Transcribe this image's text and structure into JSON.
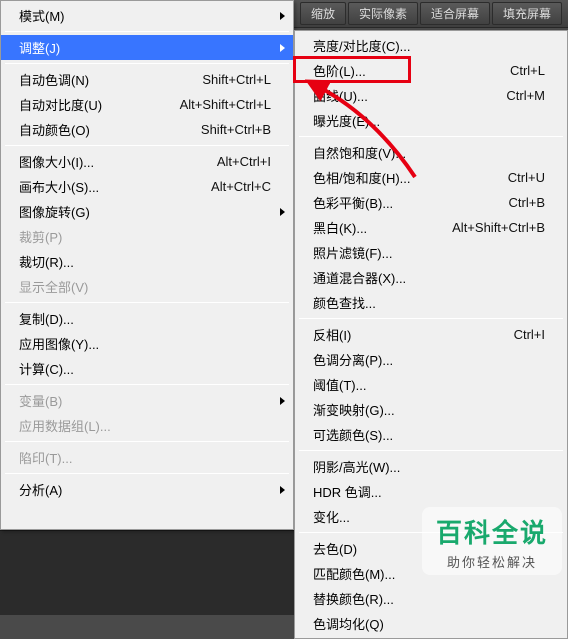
{
  "toolbar": {
    "buttons": [
      "缩放",
      "实际像素",
      "适合屏幕",
      "填充屏幕"
    ]
  },
  "left_menu": [
    {
      "type": "item",
      "label": "模式(M)",
      "shortcut": "",
      "arrow": true
    },
    {
      "type": "sep"
    },
    {
      "type": "item",
      "label": "调整(J)",
      "shortcut": "",
      "arrow": true,
      "highlight": true
    },
    {
      "type": "sep"
    },
    {
      "type": "item",
      "label": "自动色调(N)",
      "shortcut": "Shift+Ctrl+L"
    },
    {
      "type": "item",
      "label": "自动对比度(U)",
      "shortcut": "Alt+Shift+Ctrl+L"
    },
    {
      "type": "item",
      "label": "自动颜色(O)",
      "shortcut": "Shift+Ctrl+B"
    },
    {
      "type": "sep"
    },
    {
      "type": "item",
      "label": "图像大小(I)...",
      "shortcut": "Alt+Ctrl+I"
    },
    {
      "type": "item",
      "label": "画布大小(S)...",
      "shortcut": "Alt+Ctrl+C"
    },
    {
      "type": "item",
      "label": "图像旋转(G)",
      "shortcut": "",
      "arrow": true
    },
    {
      "type": "item",
      "label": "裁剪(P)",
      "disabled": true
    },
    {
      "type": "item",
      "label": "裁切(R)..."
    },
    {
      "type": "item",
      "label": "显示全部(V)",
      "disabled": true
    },
    {
      "type": "sep"
    },
    {
      "type": "item",
      "label": "复制(D)..."
    },
    {
      "type": "item",
      "label": "应用图像(Y)..."
    },
    {
      "type": "item",
      "label": "计算(C)..."
    },
    {
      "type": "sep"
    },
    {
      "type": "item",
      "label": "变量(B)",
      "arrow": true,
      "disabled": true
    },
    {
      "type": "item",
      "label": "应用数据组(L)...",
      "disabled": true
    },
    {
      "type": "sep"
    },
    {
      "type": "item",
      "label": "陷印(T)...",
      "disabled": true
    },
    {
      "type": "sep"
    },
    {
      "type": "item",
      "label": "分析(A)",
      "arrow": true
    }
  ],
  "right_menu": [
    {
      "type": "item",
      "label": "亮度/对比度(C)..."
    },
    {
      "type": "item",
      "label": "色阶(L)...",
      "shortcut": "Ctrl+L",
      "boxed": true
    },
    {
      "type": "item",
      "label": "曲线(U)...",
      "shortcut": "Ctrl+M"
    },
    {
      "type": "item",
      "label": "曝光度(E)..."
    },
    {
      "type": "sep"
    },
    {
      "type": "item",
      "label": "自然饱和度(V)..."
    },
    {
      "type": "item",
      "label": "色相/饱和度(H)...",
      "shortcut": "Ctrl+U"
    },
    {
      "type": "item",
      "label": "色彩平衡(B)...",
      "shortcut": "Ctrl+B"
    },
    {
      "type": "item",
      "label": "黑白(K)...",
      "shortcut": "Alt+Shift+Ctrl+B"
    },
    {
      "type": "item",
      "label": "照片滤镜(F)..."
    },
    {
      "type": "item",
      "label": "通道混合器(X)..."
    },
    {
      "type": "item",
      "label": "颜色查找..."
    },
    {
      "type": "sep"
    },
    {
      "type": "item",
      "label": "反相(I)",
      "shortcut": "Ctrl+I"
    },
    {
      "type": "item",
      "label": "色调分离(P)..."
    },
    {
      "type": "item",
      "label": "阈值(T)..."
    },
    {
      "type": "item",
      "label": "渐变映射(G)..."
    },
    {
      "type": "item",
      "label": "可选颜色(S)..."
    },
    {
      "type": "sep"
    },
    {
      "type": "item",
      "label": "阴影/高光(W)..."
    },
    {
      "type": "item",
      "label": "HDR 色调..."
    },
    {
      "type": "item",
      "label": "变化..."
    },
    {
      "type": "sep"
    },
    {
      "type": "item",
      "label": "去色(D)"
    },
    {
      "type": "item",
      "label": "匹配颜色(M)..."
    },
    {
      "type": "item",
      "label": "替换颜色(R)..."
    },
    {
      "type": "item",
      "label": "色调均化(Q)"
    }
  ],
  "watermark": {
    "main": "百科全说",
    "sub": "助你轻松解决"
  }
}
